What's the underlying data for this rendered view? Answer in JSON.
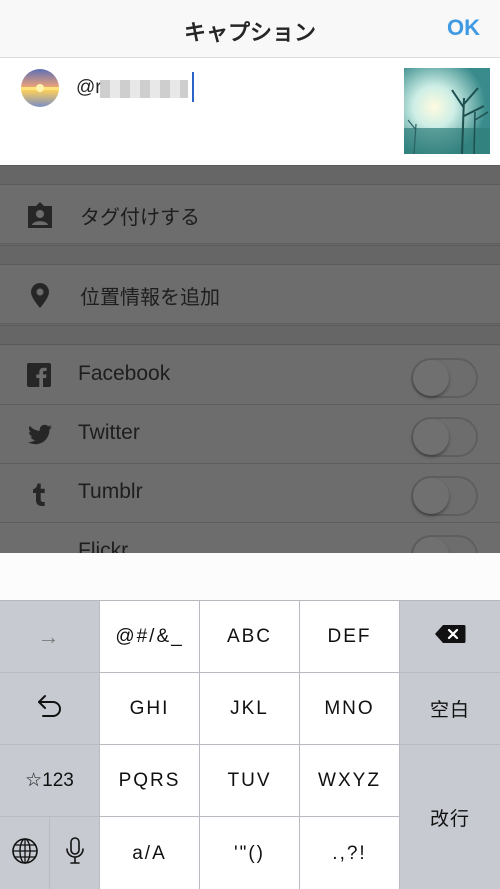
{
  "header": {
    "title": "キャプション",
    "ok_label": "OK"
  },
  "caption": {
    "text": "@r"
  },
  "settings": {
    "tag_people": "タグ付けする",
    "add_location": "位置情報を追加",
    "shares": [
      {
        "label": "Facebook",
        "icon": "facebook-icon",
        "enabled": false
      },
      {
        "label": "Twitter",
        "icon": "twitter-icon",
        "enabled": false
      },
      {
        "label": "Tumblr",
        "icon": "tumblr-icon",
        "enabled": false
      },
      {
        "label": "Flickr",
        "icon": "flickr-icon",
        "enabled": false
      }
    ]
  },
  "keyboard": {
    "row1": [
      "→",
      "@#/&_",
      "ABC",
      "DEF"
    ],
    "row2": [
      "GHI",
      "JKL",
      "MNO"
    ],
    "row3": [
      "☆123",
      "PQRS",
      "TUV",
      "WXYZ"
    ],
    "row4": [
      "a/A",
      "'\"()",
      ".,?!"
    ],
    "space": "空白",
    "return": "改行"
  },
  "colors": {
    "accent": "#3f9ae3",
    "cursor": "#2b63c9",
    "overlay": "#6d6d6d",
    "keyboard_bg": "#c7cbd1"
  }
}
